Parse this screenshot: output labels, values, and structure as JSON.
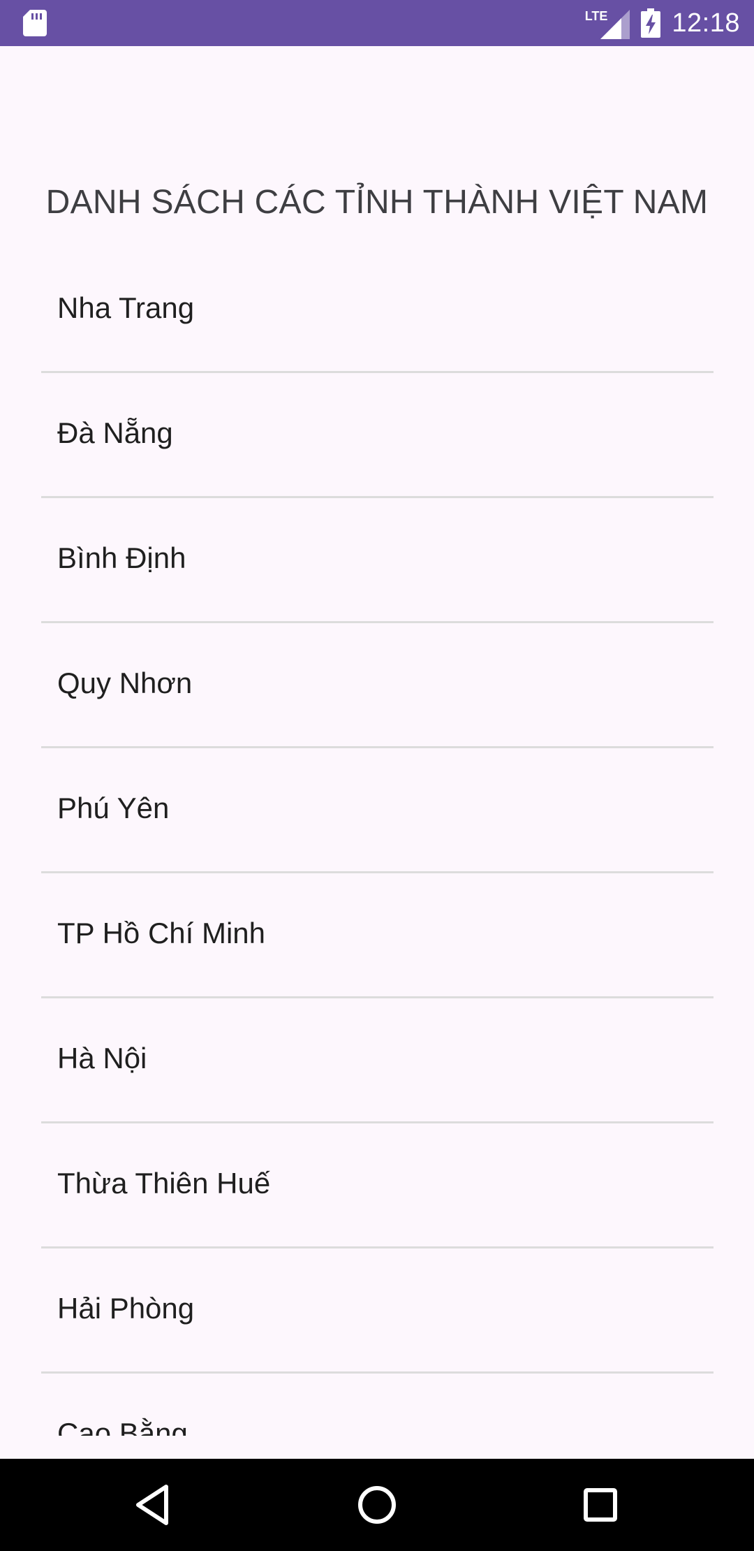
{
  "status_bar": {
    "network_label": "LTE",
    "time": "12:18",
    "icons": [
      "sd-card-icon",
      "signal-icon",
      "battery-charging-icon"
    ]
  },
  "page": {
    "title": "DANH SÁCH CÁC TỈNH THÀNH VIỆT NAM"
  },
  "list": {
    "items": [
      {
        "label": "Nha Trang"
      },
      {
        "label": "Đà Nẵng"
      },
      {
        "label": "Bình Định"
      },
      {
        "label": "Quy Nhơn"
      },
      {
        "label": "Phú Yên"
      },
      {
        "label": "TP Hồ Chí Minh"
      },
      {
        "label": "Hà Nội"
      },
      {
        "label": "Thừa Thiên Huế"
      },
      {
        "label": "Hải Phòng"
      },
      {
        "label": "Cao Bằng"
      }
    ]
  },
  "nav_bar": {
    "icons": [
      "back-icon",
      "home-icon",
      "recents-icon"
    ]
  },
  "colors": {
    "status_bar": "#6750A4",
    "background": "#FDF7FD",
    "divider": "#DCDCDC",
    "nav_bar": "#000000"
  }
}
